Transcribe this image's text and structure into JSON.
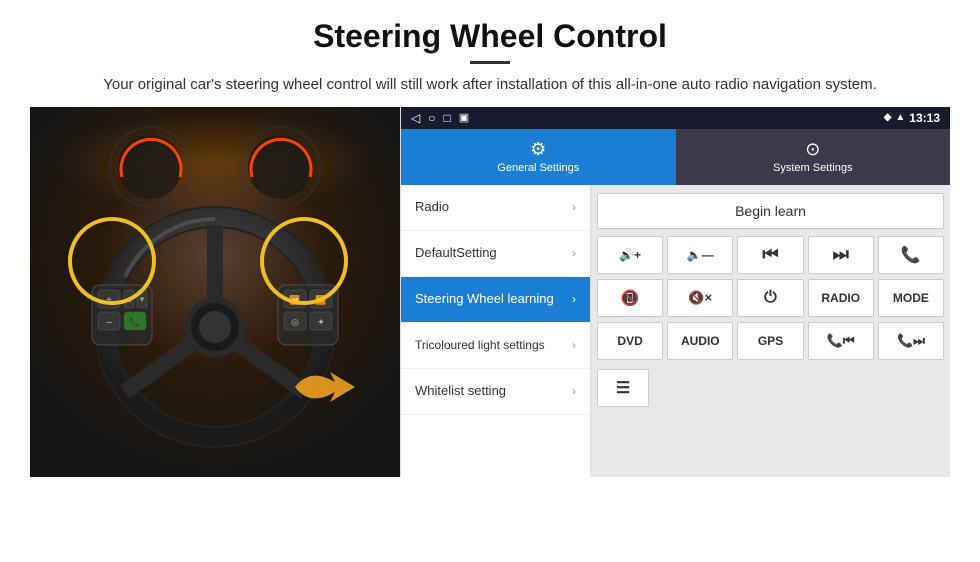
{
  "header": {
    "title": "Steering Wheel Control",
    "subtitle": "Your original car's steering wheel control will still work after installation of this all-in-one auto radio navigation system."
  },
  "statusBar": {
    "time": "13:13",
    "navIcons": [
      "◁",
      "○",
      "□",
      "▣"
    ]
  },
  "tabs": {
    "general": {
      "label": "General Settings",
      "icon": "⚙"
    },
    "system": {
      "label": "System Settings",
      "icon": "🔧"
    }
  },
  "menuItems": [
    {
      "id": "radio",
      "label": "Radio",
      "active": false
    },
    {
      "id": "default-setting",
      "label": "DefaultSetting",
      "active": false
    },
    {
      "id": "steering-wheel",
      "label": "Steering Wheel learning",
      "active": true
    },
    {
      "id": "tricoloured",
      "label": "Tricoloured light settings",
      "active": false
    },
    {
      "id": "whitelist",
      "label": "Whitelist setting",
      "active": false
    }
  ],
  "controls": {
    "beginLearn": "Begin learn",
    "row1": [
      {
        "id": "vol-up",
        "label": "🔊+",
        "type": "icon"
      },
      {
        "id": "vol-down",
        "label": "🔈-",
        "type": "icon"
      },
      {
        "id": "prev-track",
        "label": "⏮",
        "type": "icon"
      },
      {
        "id": "next-track",
        "label": "⏭",
        "type": "icon"
      },
      {
        "id": "phone",
        "label": "📞",
        "type": "icon"
      }
    ],
    "row2": [
      {
        "id": "hang-up",
        "label": "📵",
        "type": "icon"
      },
      {
        "id": "mute",
        "label": "🔇×",
        "type": "icon"
      },
      {
        "id": "power",
        "label": "⏻",
        "type": "icon"
      },
      {
        "id": "radio-btn",
        "label": "RADIO",
        "type": "text"
      },
      {
        "id": "mode-btn",
        "label": "MODE",
        "type": "text"
      }
    ],
    "row3": [
      {
        "id": "dvd-btn",
        "label": "DVD",
        "type": "text"
      },
      {
        "id": "audio-btn",
        "label": "AUDIO",
        "type": "text"
      },
      {
        "id": "gps-btn",
        "label": "GPS",
        "type": "text"
      },
      {
        "id": "tel-prev",
        "label": "📞⏮",
        "type": "icon"
      },
      {
        "id": "tel-next",
        "label": "📞⏭",
        "type": "icon"
      }
    ]
  },
  "bottomIcon": {
    "label": "≡☰"
  }
}
